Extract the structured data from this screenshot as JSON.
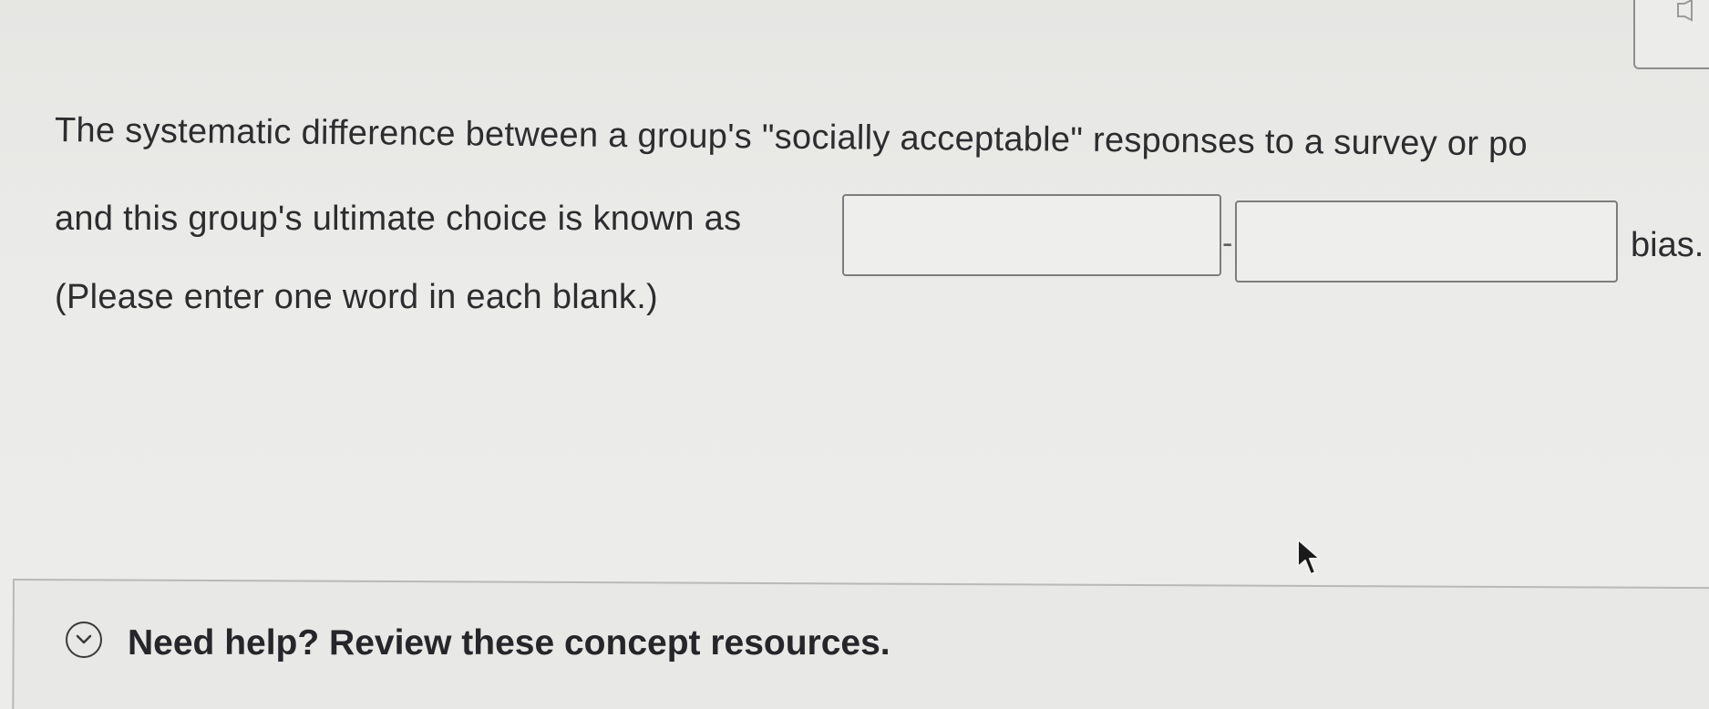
{
  "question": {
    "line1": "The systematic difference between a group's \"socially acceptable\" responses to a survey or po",
    "line2_prefix": "and this group's ultimate choice is known as",
    "separator": "-",
    "suffix": "bias.",
    "line3": "(Please enter one word in each blank.)",
    "blank1_value": "",
    "blank2_value": ""
  },
  "help": {
    "label": "Need help? Review these concept resources.",
    "toggle_icon": "chevron-down-icon"
  },
  "corner": {
    "icon": "speaker-icon"
  },
  "cursor": {
    "icon": "mouse-pointer-icon"
  }
}
